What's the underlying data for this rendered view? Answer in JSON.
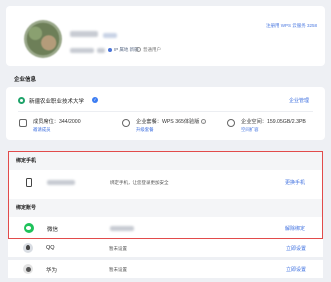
{
  "profile": {
    "ip_label": "IP 属地 新疆",
    "user_type": "普通用户",
    "user_id": "注册用 WPS 云服务 3258"
  },
  "enterprise_section": {
    "title": "企业信息",
    "org_name": "新疆农业职业技术大学",
    "manage": "企业管理",
    "stats": [
      {
        "text": "成员席位：344/2000",
        "link": "邀请成员"
      },
      {
        "text": "企业套餐：WPS 365体验版",
        "link": "升级套餐"
      },
      {
        "text": "企业空间：159.05GB/2.3PB",
        "link": "空间扩容"
      }
    ]
  },
  "bind_phone": {
    "title": "绑定手机",
    "tip": "绑定手机，让您登录更加安全",
    "action": "更换手机"
  },
  "bind_account": {
    "title": "绑定账号",
    "wechat": {
      "label": "微信",
      "action": "解除绑定"
    }
  },
  "other_accounts": [
    {
      "label": "QQ",
      "state": "暂未设置",
      "action": "立即设置"
    },
    {
      "label": "华为",
      "state": "暂未设置",
      "action": "立即设置"
    }
  ],
  "colors": {
    "accent": "#3d6fe0",
    "highlight_border": "#e24b4b",
    "wechat": "#1ec25a"
  }
}
